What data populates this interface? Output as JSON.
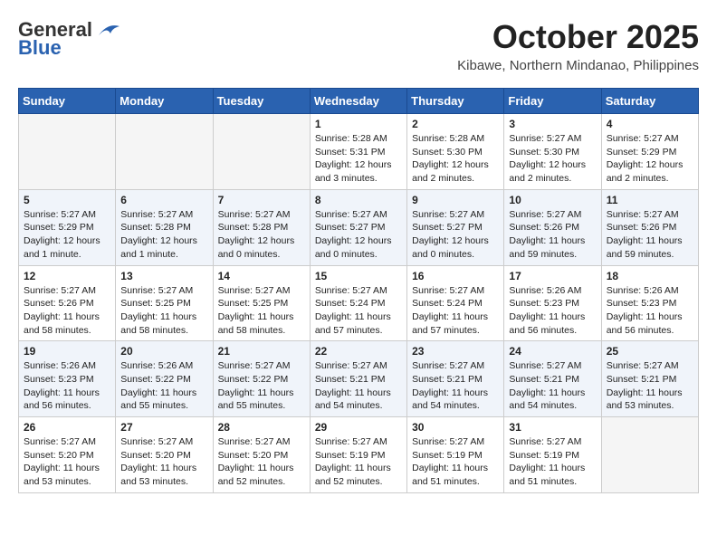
{
  "header": {
    "logo_general": "General",
    "logo_blue": "Blue",
    "month_title": "October 2025",
    "location": "Kibawe, Northern Mindanao, Philippines"
  },
  "days_of_week": [
    "Sunday",
    "Monday",
    "Tuesday",
    "Wednesday",
    "Thursday",
    "Friday",
    "Saturday"
  ],
  "weeks": [
    [
      {
        "day": "",
        "info": ""
      },
      {
        "day": "",
        "info": ""
      },
      {
        "day": "",
        "info": ""
      },
      {
        "day": "1",
        "info": "Sunrise: 5:28 AM\nSunset: 5:31 PM\nDaylight: 12 hours and 3 minutes."
      },
      {
        "day": "2",
        "info": "Sunrise: 5:28 AM\nSunset: 5:30 PM\nDaylight: 12 hours and 2 minutes."
      },
      {
        "day": "3",
        "info": "Sunrise: 5:27 AM\nSunset: 5:30 PM\nDaylight: 12 hours and 2 minutes."
      },
      {
        "day": "4",
        "info": "Sunrise: 5:27 AM\nSunset: 5:29 PM\nDaylight: 12 hours and 2 minutes."
      }
    ],
    [
      {
        "day": "5",
        "info": "Sunrise: 5:27 AM\nSunset: 5:29 PM\nDaylight: 12 hours and 1 minute."
      },
      {
        "day": "6",
        "info": "Sunrise: 5:27 AM\nSunset: 5:28 PM\nDaylight: 12 hours and 1 minute."
      },
      {
        "day": "7",
        "info": "Sunrise: 5:27 AM\nSunset: 5:28 PM\nDaylight: 12 hours and 0 minutes."
      },
      {
        "day": "8",
        "info": "Sunrise: 5:27 AM\nSunset: 5:27 PM\nDaylight: 12 hours and 0 minutes."
      },
      {
        "day": "9",
        "info": "Sunrise: 5:27 AM\nSunset: 5:27 PM\nDaylight: 12 hours and 0 minutes."
      },
      {
        "day": "10",
        "info": "Sunrise: 5:27 AM\nSunset: 5:26 PM\nDaylight: 11 hours and 59 minutes."
      },
      {
        "day": "11",
        "info": "Sunrise: 5:27 AM\nSunset: 5:26 PM\nDaylight: 11 hours and 59 minutes."
      }
    ],
    [
      {
        "day": "12",
        "info": "Sunrise: 5:27 AM\nSunset: 5:26 PM\nDaylight: 11 hours and 58 minutes."
      },
      {
        "day": "13",
        "info": "Sunrise: 5:27 AM\nSunset: 5:25 PM\nDaylight: 11 hours and 58 minutes."
      },
      {
        "day": "14",
        "info": "Sunrise: 5:27 AM\nSunset: 5:25 PM\nDaylight: 11 hours and 58 minutes."
      },
      {
        "day": "15",
        "info": "Sunrise: 5:27 AM\nSunset: 5:24 PM\nDaylight: 11 hours and 57 minutes."
      },
      {
        "day": "16",
        "info": "Sunrise: 5:27 AM\nSunset: 5:24 PM\nDaylight: 11 hours and 57 minutes."
      },
      {
        "day": "17",
        "info": "Sunrise: 5:26 AM\nSunset: 5:23 PM\nDaylight: 11 hours and 56 minutes."
      },
      {
        "day": "18",
        "info": "Sunrise: 5:26 AM\nSunset: 5:23 PM\nDaylight: 11 hours and 56 minutes."
      }
    ],
    [
      {
        "day": "19",
        "info": "Sunrise: 5:26 AM\nSunset: 5:23 PM\nDaylight: 11 hours and 56 minutes."
      },
      {
        "day": "20",
        "info": "Sunrise: 5:26 AM\nSunset: 5:22 PM\nDaylight: 11 hours and 55 minutes."
      },
      {
        "day": "21",
        "info": "Sunrise: 5:27 AM\nSunset: 5:22 PM\nDaylight: 11 hours and 55 minutes."
      },
      {
        "day": "22",
        "info": "Sunrise: 5:27 AM\nSunset: 5:21 PM\nDaylight: 11 hours and 54 minutes."
      },
      {
        "day": "23",
        "info": "Sunrise: 5:27 AM\nSunset: 5:21 PM\nDaylight: 11 hours and 54 minutes."
      },
      {
        "day": "24",
        "info": "Sunrise: 5:27 AM\nSunset: 5:21 PM\nDaylight: 11 hours and 54 minutes."
      },
      {
        "day": "25",
        "info": "Sunrise: 5:27 AM\nSunset: 5:21 PM\nDaylight: 11 hours and 53 minutes."
      }
    ],
    [
      {
        "day": "26",
        "info": "Sunrise: 5:27 AM\nSunset: 5:20 PM\nDaylight: 11 hours and 53 minutes."
      },
      {
        "day": "27",
        "info": "Sunrise: 5:27 AM\nSunset: 5:20 PM\nDaylight: 11 hours and 53 minutes."
      },
      {
        "day": "28",
        "info": "Sunrise: 5:27 AM\nSunset: 5:20 PM\nDaylight: 11 hours and 52 minutes."
      },
      {
        "day": "29",
        "info": "Sunrise: 5:27 AM\nSunset: 5:19 PM\nDaylight: 11 hours and 52 minutes."
      },
      {
        "day": "30",
        "info": "Sunrise: 5:27 AM\nSunset: 5:19 PM\nDaylight: 11 hours and 51 minutes."
      },
      {
        "day": "31",
        "info": "Sunrise: 5:27 AM\nSunset: 5:19 PM\nDaylight: 11 hours and 51 minutes."
      },
      {
        "day": "",
        "info": ""
      }
    ]
  ]
}
